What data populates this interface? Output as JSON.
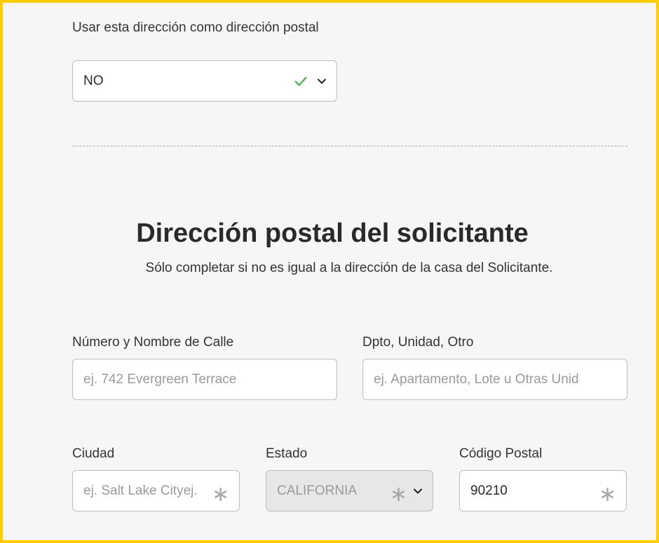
{
  "postal_toggle": {
    "label": "Usar esta dirección como dirección postal",
    "value": "NO"
  },
  "section": {
    "title": "Dirección postal del solicitante",
    "subtitle": "Sólo completar si no es igual a la dirección de la casa del Solicitante."
  },
  "street": {
    "label": "Número y Nombre de Calle",
    "placeholder": "ej. 742 Evergreen Terrace"
  },
  "unit": {
    "label": "Dpto, Unidad, Otro",
    "placeholder": "ej. Apartamento, Lote u Otras Unid"
  },
  "city": {
    "label": "Ciudad",
    "placeholder": "ej. Salt Lake Cityej."
  },
  "state": {
    "label": "Estado",
    "value": "CALIFORNIA"
  },
  "zip": {
    "label": "Código Postal",
    "value": "90210"
  },
  "colors": {
    "frame_border": "#ffcc00",
    "check_green": "#4caf50"
  }
}
